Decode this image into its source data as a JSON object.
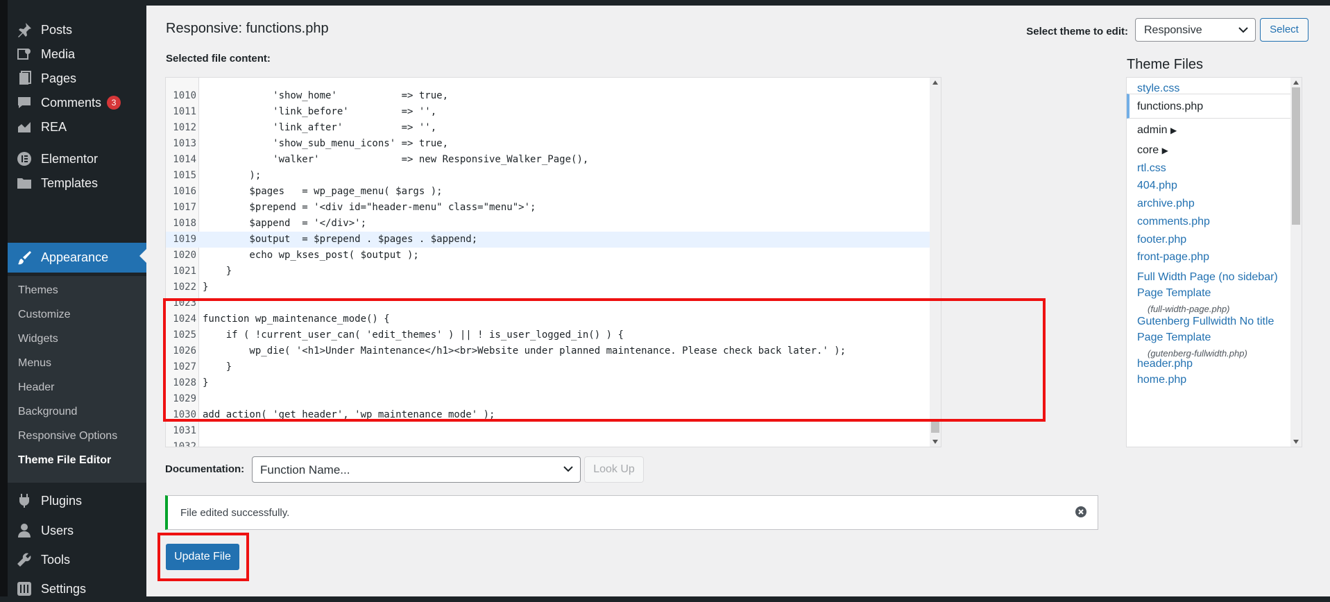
{
  "sidebar": {
    "items": [
      {
        "label": "Posts",
        "icon": "pin-icon"
      },
      {
        "label": "Media",
        "icon": "media-icon"
      },
      {
        "label": "Pages",
        "icon": "pages-icon"
      },
      {
        "label": "Comments",
        "icon": "comments-icon",
        "badge": "3"
      },
      {
        "label": "REA",
        "icon": "chart-icon"
      },
      {
        "label": "Elementor",
        "icon": "elementor-icon"
      },
      {
        "label": "Templates",
        "icon": "folder-icon"
      },
      {
        "label": "Appearance",
        "icon": "brush-icon",
        "active": true
      },
      {
        "label": "Plugins",
        "icon": "plugin-icon"
      },
      {
        "label": "Users",
        "icon": "user-icon"
      },
      {
        "label": "Tools",
        "icon": "wrench-icon"
      },
      {
        "label": "Settings",
        "icon": "settings-icon"
      }
    ],
    "submenu": [
      "Themes",
      "Customize",
      "Widgets",
      "Menus",
      "Header",
      "Background",
      "Responsive Options",
      "Theme File Editor"
    ],
    "submenu_current": "Theme File Editor"
  },
  "header": {
    "title": "Responsive: functions.php",
    "selected_file_label": "Selected file content:",
    "theme_label": "Select theme to edit:",
    "theme_value": "Responsive",
    "select_button": "Select"
  },
  "code": {
    "lines": [
      {
        "n": "1010",
        "text": "            'show_home'           => true,"
      },
      {
        "n": "1011",
        "text": "            'link_before'         => '',"
      },
      {
        "n": "1012",
        "text": "            'link_after'          => '',"
      },
      {
        "n": "1013",
        "text": "            'show_sub_menu_icons' => true,"
      },
      {
        "n": "1014",
        "text": "            'walker'              => new Responsive_Walker_Page(),"
      },
      {
        "n": "1015",
        "text": "        );"
      },
      {
        "n": "1016",
        "text": "        $pages   = wp_page_menu( $args );"
      },
      {
        "n": "1017",
        "text": "        $prepend = '<div id=\"header-menu\" class=\"menu\">';"
      },
      {
        "n": "1018",
        "text": "        $append  = '</div>';"
      },
      {
        "n": "1019",
        "text": "        $output  = $prepend . $pages . $append;",
        "highlight": true
      },
      {
        "n": "1020",
        "text": "        echo wp_kses_post( $output );"
      },
      {
        "n": "1021",
        "text": "    }"
      },
      {
        "n": "1022",
        "text": "}"
      },
      {
        "n": "1023",
        "text": ""
      },
      {
        "n": "1024",
        "text": "function wp_maintenance_mode() {"
      },
      {
        "n": "1025",
        "text": "    if ( !current_user_can( 'edit_themes' ) || ! is_user_logged_in() ) {"
      },
      {
        "n": "1026",
        "text": "        wp_die( '<h1>Under Maintenance</h1><br>Website under planned maintenance. Please check back later.' );"
      },
      {
        "n": "1027",
        "text": "    }"
      },
      {
        "n": "1028",
        "text": "}"
      },
      {
        "n": "1029",
        "text": ""
      },
      {
        "n": "1030",
        "text": "add_action( 'get_header', 'wp_maintenance_mode' );"
      },
      {
        "n": "1031",
        "text": ""
      },
      {
        "n": "1032",
        "text": ""
      }
    ]
  },
  "files": {
    "title": "Theme Files",
    "items": [
      {
        "name": "style.css"
      },
      {
        "name": "functions.php",
        "current": true
      },
      {
        "name": "admin",
        "dir": true
      },
      {
        "name": "core",
        "dir": true
      },
      {
        "name": "rtl.css"
      },
      {
        "name": "404.php"
      },
      {
        "name": "archive.php"
      },
      {
        "name": "comments.php"
      },
      {
        "name": "footer.php"
      },
      {
        "name": "front-page.php"
      },
      {
        "name": "Full Width Page (no sidebar) Page Template",
        "sub": "(full-width-page.php)"
      },
      {
        "name": "Gutenberg Fullwidth No title Page Template",
        "sub": "(gutenberg-fullwidth.php)"
      },
      {
        "name": "header.php"
      },
      {
        "name": "home.php"
      }
    ]
  },
  "documentation": {
    "label": "Documentation:",
    "placeholder": "Function Name...",
    "lookup_button": "Look Up"
  },
  "notice": {
    "message": "File edited successfully."
  },
  "update_button": "Update File",
  "colors": {
    "accent": "#2271b1",
    "sidebar_bg": "#1d2327",
    "submenu_bg": "#2c3338",
    "badge": "#d63638",
    "success": "#00a32a",
    "annotation": "#ee1111"
  }
}
